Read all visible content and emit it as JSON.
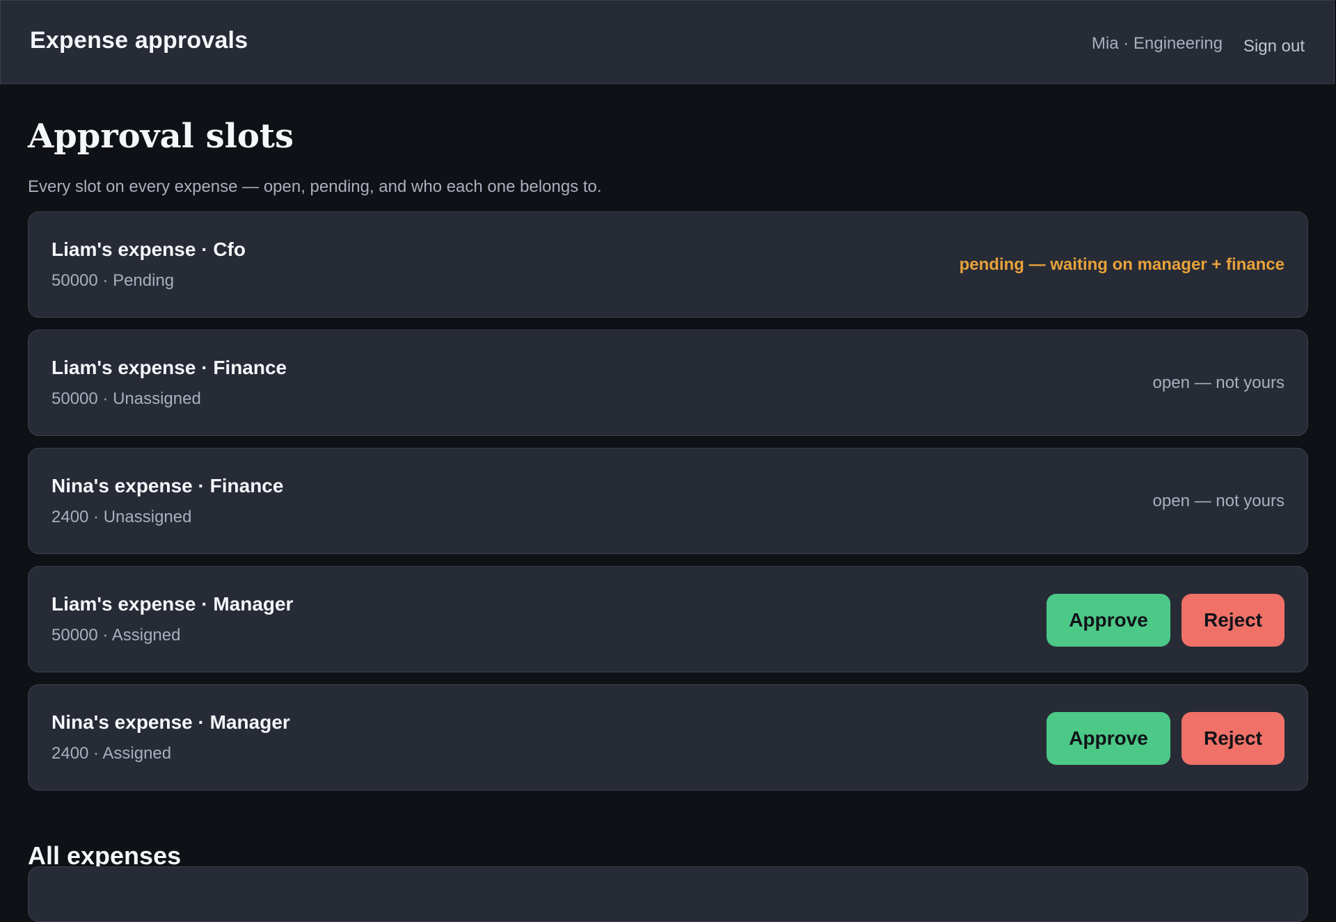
{
  "header": {
    "app_title": "Expense approvals",
    "user_info": "Mia · Engineering",
    "sign_out_label": "Sign out"
  },
  "page": {
    "title": "Approval slots",
    "subtitle": "Every slot on every expense — open, pending, and who each one belongs to."
  },
  "slots": [
    {
      "title": "Liam's expense · Cfo",
      "meta": "50000 · Pending",
      "status": "pending — waiting on manager + finance",
      "status_color": "#e8a23a"
    },
    {
      "title": "Liam's expense · Finance",
      "meta": "50000 · Unassigned",
      "status": "open — not yours"
    },
    {
      "title": "Nina's expense · Finance",
      "meta": "2400 · Unassigned",
      "status": "open — not yours"
    },
    {
      "title": "Liam's expense · Manager",
      "meta": "50000 · Assigned",
      "approve_label": "Approve",
      "reject_label": "Reject"
    },
    {
      "title": "Nina's expense · Manager",
      "meta": "2400 · Assigned",
      "approve_label": "Approve",
      "reject_label": "Reject"
    }
  ],
  "all_expenses": {
    "title": "All expenses"
  },
  "colors": {
    "background": "#0f1116",
    "surface": "#272b36",
    "approve": "#4cc887",
    "reject": "#ef7168",
    "pending": "#e8a23a"
  }
}
